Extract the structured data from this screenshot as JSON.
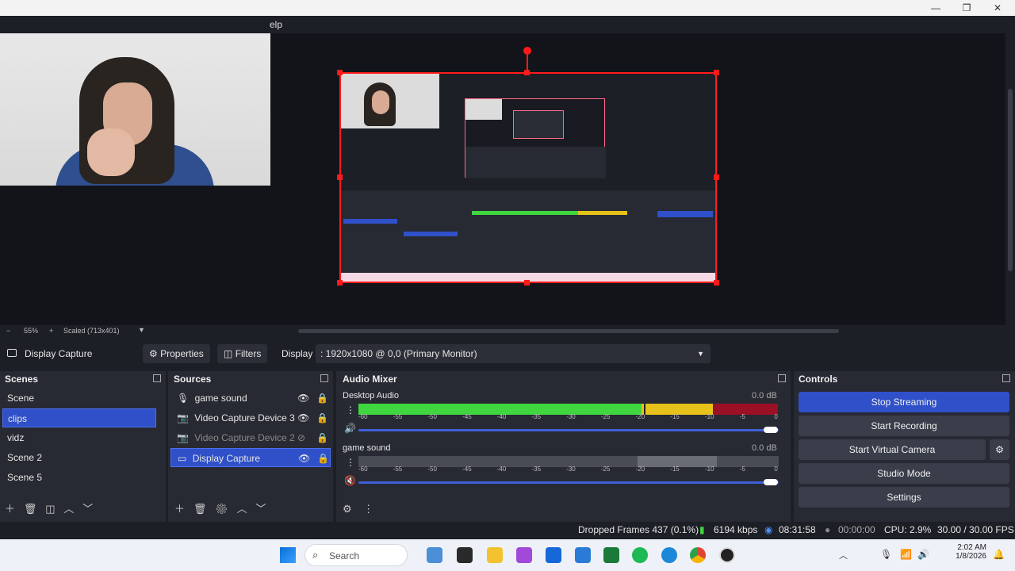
{
  "window": {
    "menu_partial": "elp",
    "minimize": "—",
    "maximize": "❐",
    "close": "✕"
  },
  "preview_footer": {
    "zoom": "55%",
    "minus": "−",
    "plus": "+",
    "scaled": "Scaled (713x401)"
  },
  "source_toolbar": {
    "source_name": "Display Capture",
    "properties": "Properties",
    "filters": "Filters",
    "display_label": "Display",
    "display_value": ": 1920x1080 @ 0,0 (Primary Monitor)"
  },
  "scenes": {
    "title": "Scenes",
    "items": [
      "Scene",
      "clips",
      "vidz",
      "Scene 2",
      "Scene 5"
    ],
    "selected_index": 1
  },
  "sources": {
    "title": "Sources",
    "items": [
      {
        "label": "game sound",
        "type": "audio",
        "visible": true
      },
      {
        "label": "Video Capture Device 3",
        "type": "camera",
        "visible": true
      },
      {
        "label": "Video Capture Device 2",
        "type": "camera",
        "visible": false
      },
      {
        "label": "Display Capture",
        "type": "display",
        "visible": true
      }
    ]
  },
  "audio_mixer": {
    "title": "Audio Mixer",
    "channels": [
      {
        "name": "Desktop Audio",
        "db": "0.0 dB",
        "level": 0.92
      },
      {
        "name": "game sound",
        "db": "0.0 dB",
        "level": 0.0
      }
    ],
    "scale": [
      "-60",
      "-55",
      "-50",
      "-45",
      "-40",
      "-35",
      "-30",
      "-25",
      "-20",
      "-15",
      "-10",
      "-5",
      "0"
    ]
  },
  "controls": {
    "title": "Controls",
    "stop_streaming": "Stop Streaming",
    "start_recording": "Start Recording",
    "start_virtual_camera": "Start Virtual Camera",
    "studio_mode": "Studio Mode",
    "settings": "Settings"
  },
  "status": {
    "dropped_frames": "Dropped Frames 437 (0.1%)",
    "bitrate": "6194 kbps",
    "stream_time": "08:31:58",
    "record_time": "00:00:00",
    "cpu": "CPU: 2.9%",
    "fps": "30.00 / 30.00 FPS"
  },
  "taskbar": {
    "search": "Search",
    "time": "2:02 AM",
    "date": "1/8/2026"
  },
  "colors": {
    "accent": "#2f50c8",
    "meter_green": "#3fd63f",
    "meter_yellow": "#e6c21a",
    "meter_red": "#c8102e"
  }
}
